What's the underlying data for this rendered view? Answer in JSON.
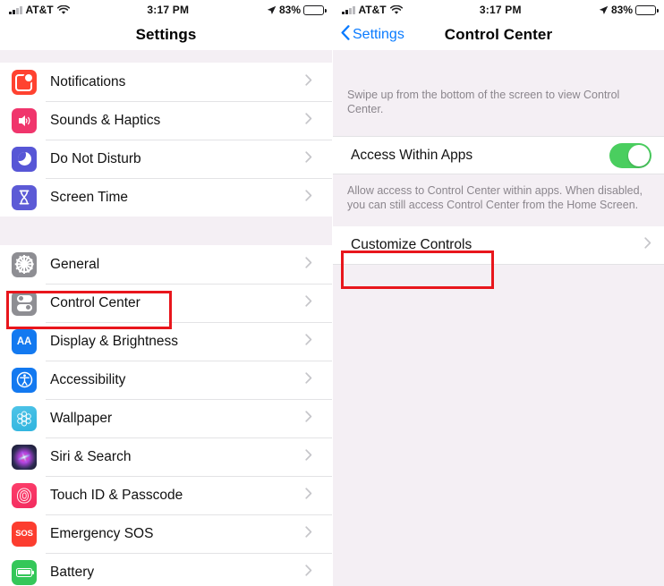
{
  "status_bar": {
    "carrier": "AT&T",
    "time": "3:17 PM",
    "battery_percent": "83%",
    "wifi_icon": "wifi-icon",
    "signal_icon": "signal-bars-icon",
    "location_icon": "location-arrow-icon",
    "battery_icon": "battery-icon"
  },
  "left_panel": {
    "title": "Settings",
    "groups": [
      {
        "rows": [
          {
            "label": "Notifications",
            "icon": "notifications-icon",
            "color": "#ff4230"
          },
          {
            "label": "Sounds & Haptics",
            "icon": "speaker-icon",
            "color": "#f0356c"
          },
          {
            "label": "Do Not Disturb",
            "icon": "moon-icon",
            "color": "#5756d6"
          },
          {
            "label": "Screen Time",
            "icon": "hourglass-icon",
            "color": "#5c5ad6"
          }
        ]
      },
      {
        "rows": [
          {
            "label": "General",
            "icon": "gear-icon",
            "color": "#8e8e93"
          },
          {
            "label": "Control Center",
            "icon": "control-center-icon",
            "color": "#8e8e93"
          },
          {
            "label": "Display & Brightness",
            "icon": "text-size-icon",
            "color": "#1379f0"
          },
          {
            "label": "Accessibility",
            "icon": "accessibility-icon",
            "color": "#1379f0"
          },
          {
            "label": "Wallpaper",
            "icon": "flower-icon",
            "color": "#3ab9e0"
          },
          {
            "label": "Siri & Search",
            "icon": "siri-icon",
            "color": "#1d1b33"
          },
          {
            "label": "Touch ID & Passcode",
            "icon": "fingerprint-icon",
            "color": "#f8305e"
          },
          {
            "label": "Emergency SOS",
            "icon": "sos-icon",
            "color": "#fc3d2f"
          },
          {
            "label": "Battery",
            "icon": "battery-green-icon",
            "color": "#34c759"
          }
        ]
      }
    ],
    "highlight": {
      "target": "Control Center",
      "color": "#e8161c"
    }
  },
  "right_panel": {
    "back_label": "Settings",
    "title": "Control Center",
    "back_icon": "chevron-left-icon",
    "top_note": "Swipe up from the bottom of the screen to view Control Center.",
    "toggle_row": {
      "label": "Access Within Apps",
      "state": "on",
      "on_color": "#4ace5f"
    },
    "mid_note": "Allow access to Control Center within apps. When disabled, you can still access Control Center from the Home Screen.",
    "link_row": {
      "label": "Customize Controls",
      "chevron": "chevron-right-icon"
    },
    "highlight": {
      "target": "Customize Controls",
      "color": "#e8161c"
    }
  },
  "icons": {
    "sos_text": "SOS",
    "aa_text": "AA",
    "hourglass_glyph": "⧗",
    "person_glyph": "Ɣ"
  }
}
